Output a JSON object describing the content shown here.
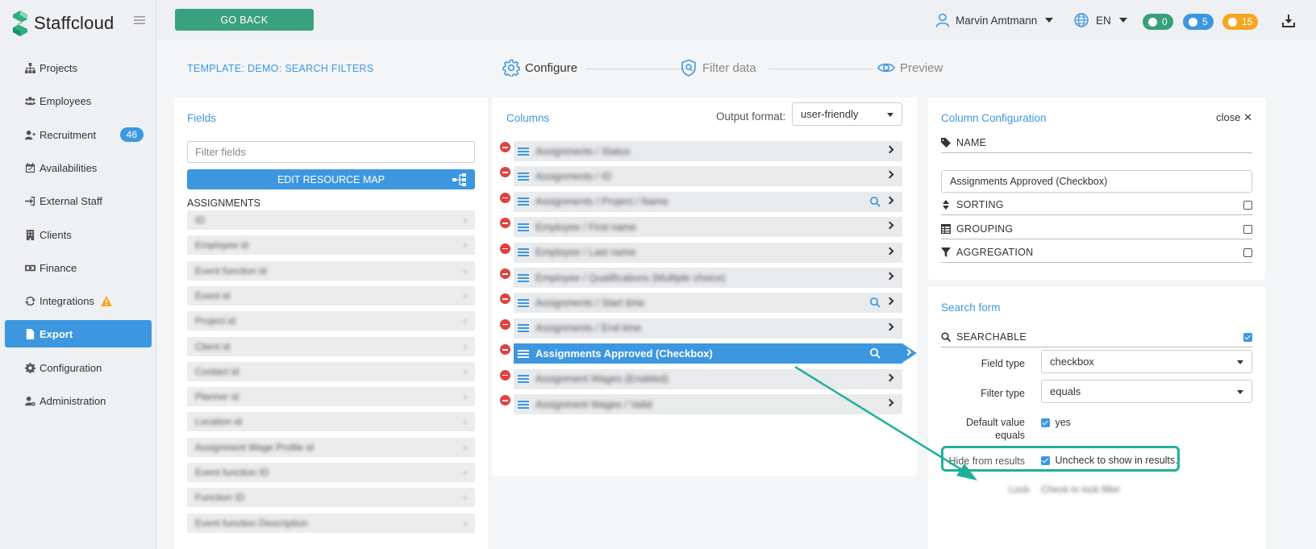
{
  "app": {
    "name": "Staffcloud"
  },
  "sidebar": {
    "items": [
      {
        "label": "Projects",
        "icon": "sitemap-icon"
      },
      {
        "label": "Employees",
        "icon": "users-icon"
      },
      {
        "label": "Recruitment",
        "icon": "user-plus-icon",
        "badge": "46"
      },
      {
        "label": "Availabilities",
        "icon": "calendar-check-icon"
      },
      {
        "label": "External Staff",
        "icon": "sign-in-icon"
      },
      {
        "label": "Clients",
        "icon": "building-icon"
      },
      {
        "label": "Finance",
        "icon": "money-icon"
      },
      {
        "label": "Integrations",
        "icon": "sync-icon",
        "warning": true
      },
      {
        "label": "Export",
        "icon": "file-icon",
        "active": true
      },
      {
        "label": "Configuration",
        "icon": "gear-icon"
      },
      {
        "label": "Administration",
        "icon": "user-gear-icon"
      }
    ]
  },
  "topbar": {
    "go_back": "GO BACK",
    "user_name": "Marvin Amtmann",
    "language": "EN",
    "pills": [
      {
        "count": "0",
        "color": "#36a07a",
        "icon": "chat-icon"
      },
      {
        "count": "5",
        "color": "#3d97e0",
        "icon": "bell-icon"
      },
      {
        "count": "15",
        "color": "#f5a623",
        "icon": "clock-icon"
      }
    ]
  },
  "header": {
    "template_title": "TEMPLATE: DEMO: SEARCH FILTERS",
    "steps": [
      {
        "label": "Configure",
        "active": true,
        "icon": "gear-icon"
      },
      {
        "label": "Filter data",
        "active": false,
        "icon": "shield-search-icon"
      },
      {
        "label": "Preview",
        "active": false,
        "icon": "eye-icon"
      }
    ]
  },
  "fields_panel": {
    "title": "Fields",
    "filter_placeholder": "Filter fields",
    "edit_button": "EDIT RESOURCE MAP",
    "section": "ASSIGNMENTS",
    "rows": [
      "ID",
      "Employee id",
      "Event function id",
      "Event id",
      "Project id",
      "Client id",
      "Contact id",
      "Planner id",
      "Location id",
      "Assignment Wage Profile id",
      "Event function ID",
      "Function ID",
      "Event function Description"
    ]
  },
  "columns_panel": {
    "title": "Columns",
    "output_label": "Output format:",
    "output_value": "user-friendly",
    "rows": [
      {
        "label": "Assignments / Status",
        "search": false
      },
      {
        "label": "Assignments / ID",
        "search": false
      },
      {
        "label": "Assignments / Project / Name",
        "search": true
      },
      {
        "label": "Employee / First name",
        "search": false
      },
      {
        "label": "Employee / Last name",
        "search": false
      },
      {
        "label": "Employee / Qualifications (Multiple choice)",
        "search": false
      },
      {
        "label": "Assignments / Start time",
        "search": true
      },
      {
        "label": "Assignments / End time",
        "search": false
      },
      {
        "label": "Assignments Approved (Checkbox)",
        "search": true,
        "active": true
      },
      {
        "label": "Assignment Wages (Enabled)",
        "search": false
      },
      {
        "label": "Assignment Wages / Valid",
        "search": false
      }
    ]
  },
  "column_config": {
    "title": "Column Configuration",
    "close": "close",
    "name_label": "NAME",
    "name_value": "Assignments Approved (Checkbox)",
    "sorting": "SORTING",
    "grouping": "GROUPING",
    "aggregation": "AGGREGATION"
  },
  "search_form": {
    "title": "Search form",
    "searchable": "SEARCHABLE",
    "field_type_label": "Field type",
    "field_type_value": "checkbox",
    "filter_type_label": "Filter type",
    "filter_type_value": "equals",
    "default_label_1": "Default value",
    "default_label_2": "equals",
    "default_value": "yes",
    "hide_label": "Hide from results",
    "hide_value": "Uncheck to show in results.",
    "lock_label": "Lock",
    "lock_value": "Check to lock filter"
  },
  "colors": {
    "accent": "#3d97e0",
    "highlight": "#20b09a",
    "go_back": "#3aa17e",
    "remove": "#e0413f"
  }
}
